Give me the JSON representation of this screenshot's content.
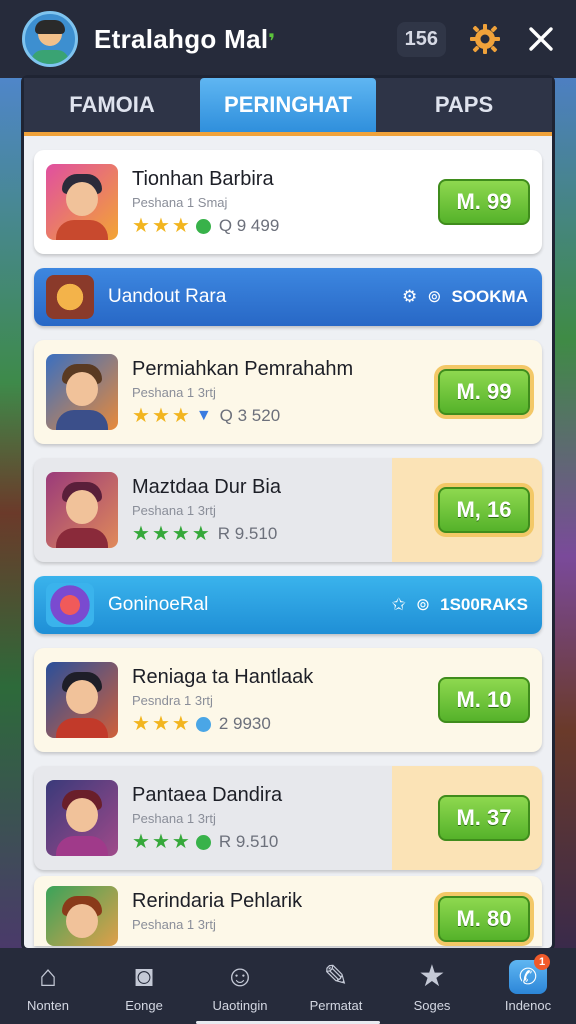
{
  "header": {
    "title": "Etralahgo Mal",
    "counter": "156",
    "icons": {
      "avatar": "user-avatar",
      "settings": "gear-icon",
      "close": "close-icon"
    },
    "accent": "#f0a23a"
  },
  "tabs": [
    {
      "label": "FAMOIA",
      "active": false
    },
    {
      "label": "PERINGHAT",
      "active": true
    },
    {
      "label": "PAPS",
      "active": false
    }
  ],
  "items": [
    {
      "name": "Tionhan Barbira",
      "subtitle": "Peshana 1 Smaj",
      "stars": 3,
      "star_color": "gold",
      "badge": "green-dot",
      "count": "Q 9 499",
      "price": "M. 99",
      "style": "white"
    },
    {
      "banner": true,
      "label": "Uandout Rara",
      "icon1": "settings-icon",
      "icon2": "coin-icon",
      "value": "SOOKMA",
      "color": "blue"
    },
    {
      "name": "Permiahkan Pemrahahm",
      "subtitle": "Peshana 1 3rtj",
      "stars": 3,
      "star_color": "gold",
      "badge": "shirt",
      "count": "Q 3 520",
      "price": "M. 99",
      "style": "cream"
    },
    {
      "name": "Maztdaa Dur Bia",
      "subtitle": "Peshana 1 3rtj",
      "stars": 4,
      "star_color": "green",
      "badge": "none",
      "count": "R 9.510",
      "price": "M, 16",
      "style": "split"
    },
    {
      "banner": true,
      "label": "GoninoeRal",
      "icon1": "star-icon",
      "icon2": "coin-icon",
      "value": "1S00RAKS",
      "color": "cyan"
    },
    {
      "name": "Reniaga ta Hantlaak",
      "subtitle": "Pesndra 1 3rtj",
      "stars": 3,
      "star_color": "gold",
      "badge": "blue-dot",
      "count": "2 9930",
      "price": "M. 10",
      "style": "white"
    },
    {
      "name": "Pantaea Dandira",
      "subtitle": "Peshana 1 3rtj",
      "stars": 3,
      "star_color": "green",
      "badge": "green-dot",
      "count": "R 9.510",
      "price": "M. 37",
      "style": "split"
    },
    {
      "name": "Rerindaria Pehlarik",
      "subtitle": "Peshana 1 3rtj",
      "stars": 0,
      "star_color": "gold",
      "badge": "none",
      "count": "",
      "price": "M. 80",
      "style": "cream"
    }
  ],
  "nav": [
    {
      "label": "Nonten",
      "icon": "home-icon"
    },
    {
      "label": "Eonge",
      "icon": "camera-icon"
    },
    {
      "label": "Uaotingin",
      "icon": "smile-icon"
    },
    {
      "label": "Permatat",
      "icon": "edit-icon"
    },
    {
      "label": "Soges",
      "icon": "star-icon"
    },
    {
      "label": "Indenoc",
      "icon": "chat-icon",
      "badge": "1"
    }
  ]
}
